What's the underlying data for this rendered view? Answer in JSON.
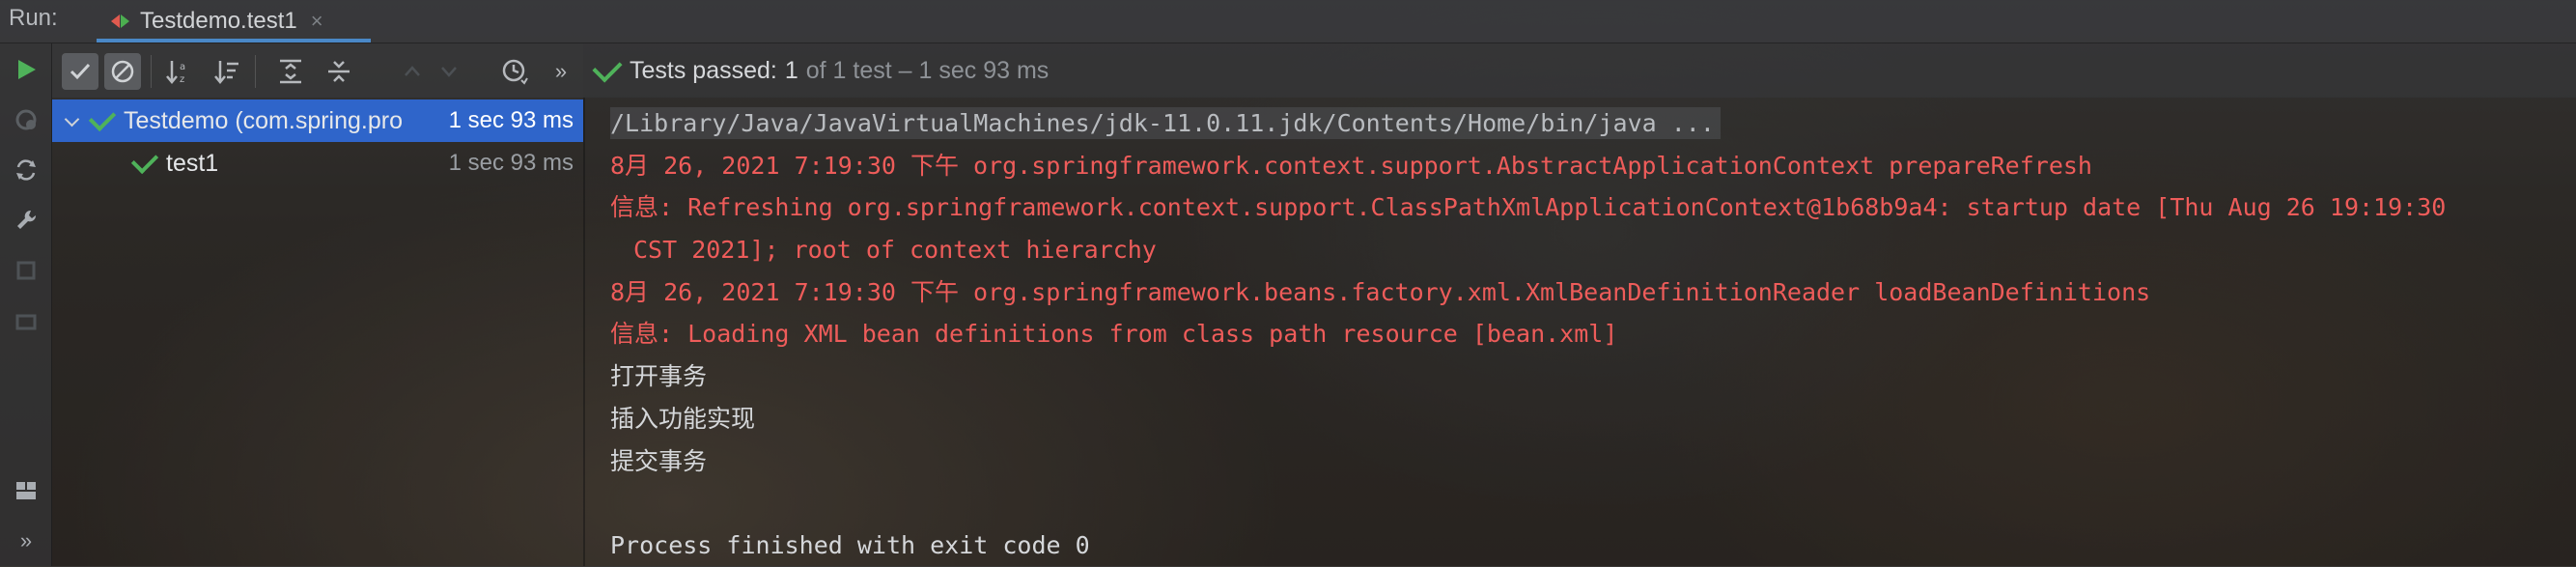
{
  "run_bar": {
    "label": "Run:",
    "tab_title": "Testdemo.test1",
    "tab_close": "×"
  },
  "left_toolbar": {
    "icons": [
      "run-icon",
      "rerun-failed-icon",
      "toggle-auto-test-icon",
      "settings-wrench-icon",
      "layout-icon",
      "more-icon"
    ],
    "more_label": "»"
  },
  "test_toolbar": {
    "icons": [
      "show-passed-icon",
      "show-ignored-icon",
      "sort-alphabetically-icon",
      "sort-by-duration-icon",
      "expand-all-icon",
      "collapse-all-icon",
      "test-history-icon"
    ],
    "more_label": "»"
  },
  "status": {
    "passed_label": "Tests passed:",
    "passed_count": "1",
    "rest": "of 1 test – 1 sec 93 ms"
  },
  "tree": {
    "root": {
      "name": "Testdemo (com.spring.pro",
      "time": "1 sec 93 ms"
    },
    "child": {
      "name": "test1",
      "time": "1 sec 93 ms"
    }
  },
  "console": {
    "lines": [
      "/Library/Java/JavaVirtualMachines/jdk-11.0.11.jdk/Contents/Home/bin/java ...",
      "8月 26, 2021 7:19:30 下午 org.springframework.context.support.AbstractApplicationContext prepareRefresh",
      "信息: Refreshing org.springframework.context.support.ClassPathXmlApplicationContext@1b68b9a4: startup date [Thu Aug 26 19:19:30",
      "CST 2021]; root of context hierarchy",
      "8月 26, 2021 7:19:30 下午 org.springframework.beans.factory.xml.XmlBeanDefinitionReader loadBeanDefinitions",
      "信息: Loading XML bean definitions from class path resource [bean.xml]",
      "打开事务",
      "插入功能实现",
      "提交事务",
      "",
      "Process finished with exit code 0"
    ]
  },
  "colors": {
    "error_text": "#ee5c5a",
    "pass_green": "#4fb25a",
    "selection": "#2f65ca",
    "tab_underline": "#4a88c7"
  }
}
